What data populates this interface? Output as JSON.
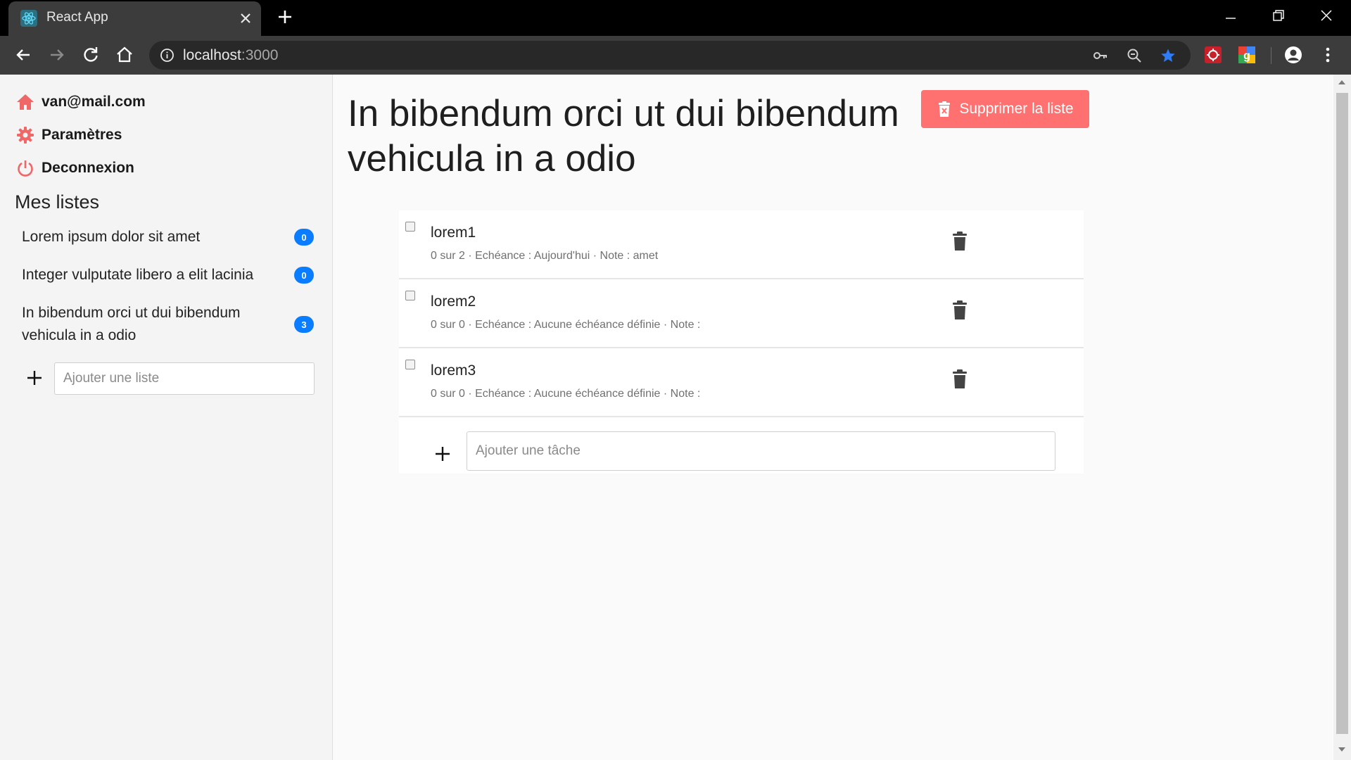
{
  "browser": {
    "tab_title": "React App",
    "url_host": "localhost",
    "url_port": ":3000",
    "icons": [
      "react-icon",
      "close-icon",
      "plus-icon",
      "back-icon",
      "forward-icon",
      "reload-icon",
      "home-icon",
      "info-icon",
      "key-icon",
      "zoom-out-icon",
      "star-icon",
      "extension-icon",
      "account-icon",
      "more-icon"
    ]
  },
  "sidebar": {
    "user_email": "van@mail.com",
    "settings_label": "Paramètres",
    "logout_label": "Deconnexion",
    "lists_heading": "Mes listes",
    "lists": [
      {
        "label": "Lorem ipsum dolor sit amet",
        "count": "0"
      },
      {
        "label": "Integer vulputate libero a elit lacinia",
        "count": "0"
      },
      {
        "label": "In bibendum orci ut dui bibendum vehicula in a odio",
        "count": "3"
      }
    ],
    "add_list_placeholder": "Ajouter une liste"
  },
  "main": {
    "title": "In bibendum orci ut dui bibendum vehicula in a odio",
    "delete_list_label": "Supprimer la liste",
    "tasks": [
      {
        "name": "lorem1",
        "meta": "0 sur 2 · Echéance : Aujourd'hui · Note : amet",
        "checked": false
      },
      {
        "name": "lorem2",
        "meta": "0 sur 0 · Echéance : Aucune échéance définie · Note :",
        "checked": false
      },
      {
        "name": "lorem3",
        "meta": "0 sur 0 · Echéance : Aucune échéance définie · Note :",
        "checked": false
      }
    ],
    "add_task_placeholder": "Ajouter une tâche"
  },
  "colors": {
    "accent_red": "#ff7070",
    "icon_red": "#f06767",
    "badge_blue": "#0a7cff",
    "chrome_dark": "#3c3c3c"
  }
}
